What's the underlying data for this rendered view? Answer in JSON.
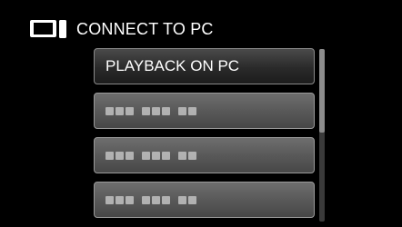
{
  "header": {
    "icon": "connect-to-pc-icon",
    "title": "CONNECT TO PC"
  },
  "menu": {
    "items": [
      {
        "label": "PLAYBACK ON PC",
        "state": "selected"
      },
      {
        "label": "",
        "state": "dimmed"
      },
      {
        "label": "",
        "state": "dimmed"
      },
      {
        "label": "",
        "state": "dimmed"
      }
    ]
  },
  "colors": {
    "background": "#000000",
    "selected_button": "#2e2e2e",
    "dimmed_button": "#5a5a5a",
    "text": "#ffffff"
  }
}
